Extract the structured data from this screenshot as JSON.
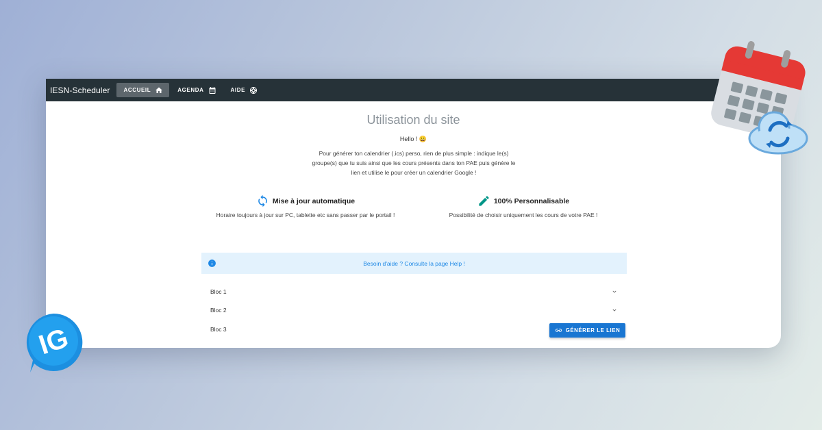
{
  "navbar": {
    "brand": "IESN-Scheduler",
    "items": [
      {
        "label": "ACCUEIL",
        "icon": "home-icon",
        "active": true
      },
      {
        "label": "AGENDA",
        "icon": "calendar-icon",
        "active": false
      },
      {
        "label": "AIDE",
        "icon": "lifebuoy-icon",
        "active": false
      }
    ]
  },
  "main": {
    "title": "Utilisation du site",
    "hello": "Hello ! 😀",
    "intro": "Pour générer ton calendrier (.ics) perso, rien de plus simple : indique le(s) groupe(s) que tu suis ainsi que les cours présents dans ton PAE puis génère le lien et utilise le pour créer un calendrier Google !",
    "features": [
      {
        "title": "Mise à jour automatique",
        "description": "Horaire toujours à jour sur PC, tablette etc sans passer par le portail !",
        "icon": "sync-icon"
      },
      {
        "title": "100% Personnalisable",
        "description": "Possibilité de choisir uniquement les cours de votre PAE !",
        "icon": "pencil-icon"
      }
    ],
    "alert": {
      "text": "Besoin d'aide ? Consulte la page Help !",
      "icon": "info-icon"
    },
    "blocs": [
      "Bloc 1",
      "Bloc 2",
      "Bloc 3"
    ],
    "generate_button": "GÉNÉRER LE LIEN"
  },
  "colors": {
    "navbar": "#263238",
    "primary": "#1976d2",
    "alert_bg": "#e3f2fd",
    "alert_text": "#1e88e5",
    "feature_icon_sync": "#1e88e5",
    "feature_icon_pencil": "#009688"
  },
  "decor": {
    "logo_text": "IG",
    "illustration": "calendar-cloud-sync-icon"
  }
}
